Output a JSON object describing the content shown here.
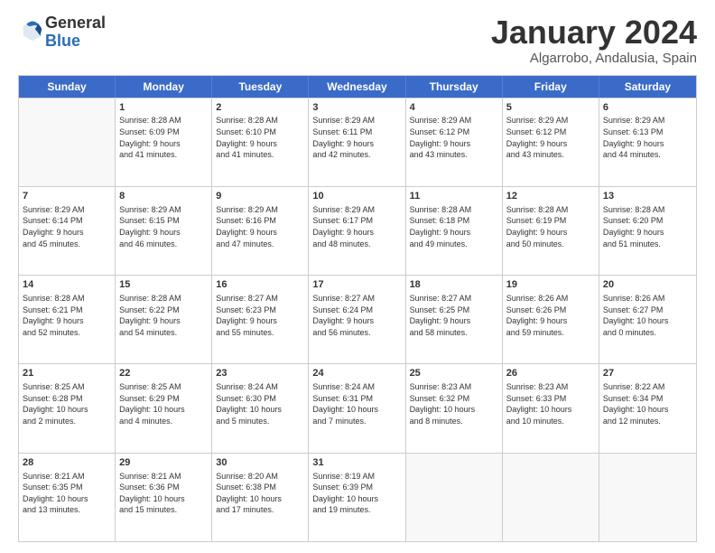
{
  "header": {
    "logo_general": "General",
    "logo_blue": "Blue",
    "month_title": "January 2024",
    "location": "Algarrobo, Andalusia, Spain"
  },
  "days_of_week": [
    "Sunday",
    "Monday",
    "Tuesday",
    "Wednesday",
    "Thursday",
    "Friday",
    "Saturday"
  ],
  "weeks": [
    [
      {
        "day": "",
        "info": ""
      },
      {
        "day": "1",
        "info": "Sunrise: 8:28 AM\nSunset: 6:09 PM\nDaylight: 9 hours\nand 41 minutes."
      },
      {
        "day": "2",
        "info": "Sunrise: 8:28 AM\nSunset: 6:10 PM\nDaylight: 9 hours\nand 41 minutes."
      },
      {
        "day": "3",
        "info": "Sunrise: 8:29 AM\nSunset: 6:11 PM\nDaylight: 9 hours\nand 42 minutes."
      },
      {
        "day": "4",
        "info": "Sunrise: 8:29 AM\nSunset: 6:12 PM\nDaylight: 9 hours\nand 43 minutes."
      },
      {
        "day": "5",
        "info": "Sunrise: 8:29 AM\nSunset: 6:12 PM\nDaylight: 9 hours\nand 43 minutes."
      },
      {
        "day": "6",
        "info": "Sunrise: 8:29 AM\nSunset: 6:13 PM\nDaylight: 9 hours\nand 44 minutes."
      }
    ],
    [
      {
        "day": "7",
        "info": "Sunrise: 8:29 AM\nSunset: 6:14 PM\nDaylight: 9 hours\nand 45 minutes."
      },
      {
        "day": "8",
        "info": "Sunrise: 8:29 AM\nSunset: 6:15 PM\nDaylight: 9 hours\nand 46 minutes."
      },
      {
        "day": "9",
        "info": "Sunrise: 8:29 AM\nSunset: 6:16 PM\nDaylight: 9 hours\nand 47 minutes."
      },
      {
        "day": "10",
        "info": "Sunrise: 8:29 AM\nSunset: 6:17 PM\nDaylight: 9 hours\nand 48 minutes."
      },
      {
        "day": "11",
        "info": "Sunrise: 8:28 AM\nSunset: 6:18 PM\nDaylight: 9 hours\nand 49 minutes."
      },
      {
        "day": "12",
        "info": "Sunrise: 8:28 AM\nSunset: 6:19 PM\nDaylight: 9 hours\nand 50 minutes."
      },
      {
        "day": "13",
        "info": "Sunrise: 8:28 AM\nSunset: 6:20 PM\nDaylight: 9 hours\nand 51 minutes."
      }
    ],
    [
      {
        "day": "14",
        "info": "Sunrise: 8:28 AM\nSunset: 6:21 PM\nDaylight: 9 hours\nand 52 minutes."
      },
      {
        "day": "15",
        "info": "Sunrise: 8:28 AM\nSunset: 6:22 PM\nDaylight: 9 hours\nand 54 minutes."
      },
      {
        "day": "16",
        "info": "Sunrise: 8:27 AM\nSunset: 6:23 PM\nDaylight: 9 hours\nand 55 minutes."
      },
      {
        "day": "17",
        "info": "Sunrise: 8:27 AM\nSunset: 6:24 PM\nDaylight: 9 hours\nand 56 minutes."
      },
      {
        "day": "18",
        "info": "Sunrise: 8:27 AM\nSunset: 6:25 PM\nDaylight: 9 hours\nand 58 minutes."
      },
      {
        "day": "19",
        "info": "Sunrise: 8:26 AM\nSunset: 6:26 PM\nDaylight: 9 hours\nand 59 minutes."
      },
      {
        "day": "20",
        "info": "Sunrise: 8:26 AM\nSunset: 6:27 PM\nDaylight: 10 hours\nand 0 minutes."
      }
    ],
    [
      {
        "day": "21",
        "info": "Sunrise: 8:25 AM\nSunset: 6:28 PM\nDaylight: 10 hours\nand 2 minutes."
      },
      {
        "day": "22",
        "info": "Sunrise: 8:25 AM\nSunset: 6:29 PM\nDaylight: 10 hours\nand 4 minutes."
      },
      {
        "day": "23",
        "info": "Sunrise: 8:24 AM\nSunset: 6:30 PM\nDaylight: 10 hours\nand 5 minutes."
      },
      {
        "day": "24",
        "info": "Sunrise: 8:24 AM\nSunset: 6:31 PM\nDaylight: 10 hours\nand 7 minutes."
      },
      {
        "day": "25",
        "info": "Sunrise: 8:23 AM\nSunset: 6:32 PM\nDaylight: 10 hours\nand 8 minutes."
      },
      {
        "day": "26",
        "info": "Sunrise: 8:23 AM\nSunset: 6:33 PM\nDaylight: 10 hours\nand 10 minutes."
      },
      {
        "day": "27",
        "info": "Sunrise: 8:22 AM\nSunset: 6:34 PM\nDaylight: 10 hours\nand 12 minutes."
      }
    ],
    [
      {
        "day": "28",
        "info": "Sunrise: 8:21 AM\nSunset: 6:35 PM\nDaylight: 10 hours\nand 13 minutes."
      },
      {
        "day": "29",
        "info": "Sunrise: 8:21 AM\nSunset: 6:36 PM\nDaylight: 10 hours\nand 15 minutes."
      },
      {
        "day": "30",
        "info": "Sunrise: 8:20 AM\nSunset: 6:38 PM\nDaylight: 10 hours\nand 17 minutes."
      },
      {
        "day": "31",
        "info": "Sunrise: 8:19 AM\nSunset: 6:39 PM\nDaylight: 10 hours\nand 19 minutes."
      },
      {
        "day": "",
        "info": ""
      },
      {
        "day": "",
        "info": ""
      },
      {
        "day": "",
        "info": ""
      }
    ]
  ]
}
